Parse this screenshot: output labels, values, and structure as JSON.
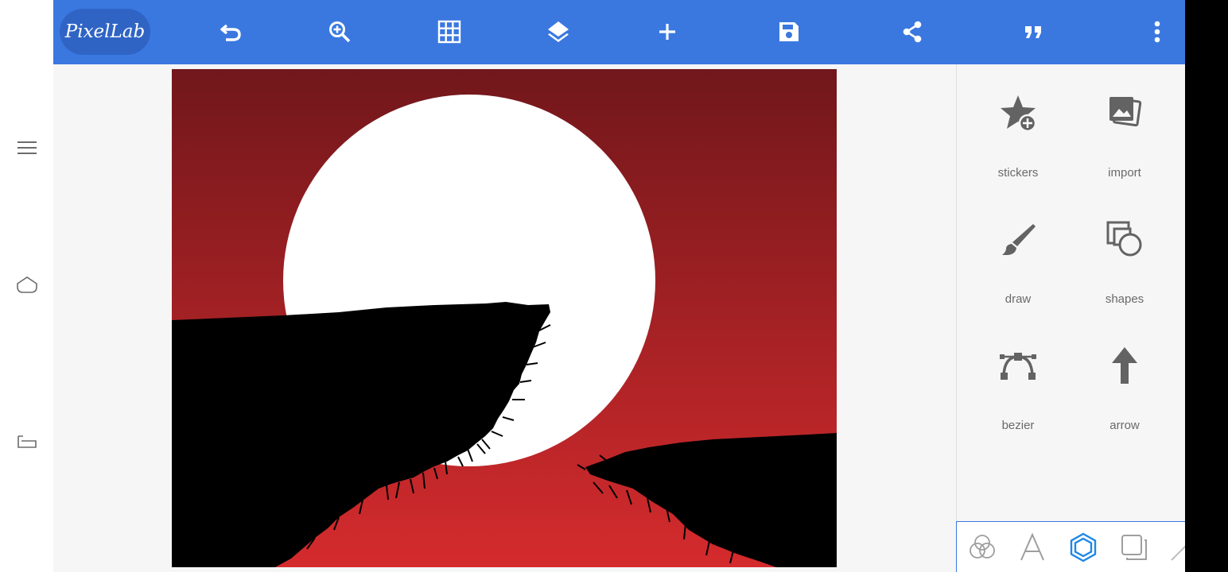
{
  "app": {
    "logo_text": "PixelLab"
  },
  "toolbar": {
    "icons": [
      "undo-icon",
      "zoom-in-icon",
      "grid-icon",
      "layers-icon",
      "add-icon",
      "save-icon",
      "share-icon",
      "quote-icon",
      "more-vert-icon"
    ]
  },
  "navigation": {
    "icons": [
      "menu-icon",
      "home-icon",
      "back-icon"
    ]
  },
  "panel": {
    "tools": [
      {
        "label": "stickers",
        "icon": "star-plus-icon"
      },
      {
        "label": "import",
        "icon": "image-stack-icon"
      },
      {
        "label": "draw",
        "icon": "brush-icon"
      },
      {
        "label": "shapes",
        "icon": "shapes-icon"
      },
      {
        "label": "bezier",
        "icon": "bezier-icon"
      },
      {
        "label": "arrow",
        "icon": "arrow-up-icon"
      }
    ],
    "bottom_tabs": [
      "color-circles-icon",
      "text-icon",
      "hexagon-icon",
      "layers-square-icon",
      "line-icon"
    ],
    "active_tab": "hexagon-icon"
  },
  "colors": {
    "toolbar": "#3a78e0",
    "logo_bg": "#2f64c5",
    "canvas_top": "#71171b",
    "canvas_bottom": "#d52b2d",
    "moon": "#ffffff",
    "silhouette": "#000000",
    "active_tab": "#1e88e5"
  }
}
